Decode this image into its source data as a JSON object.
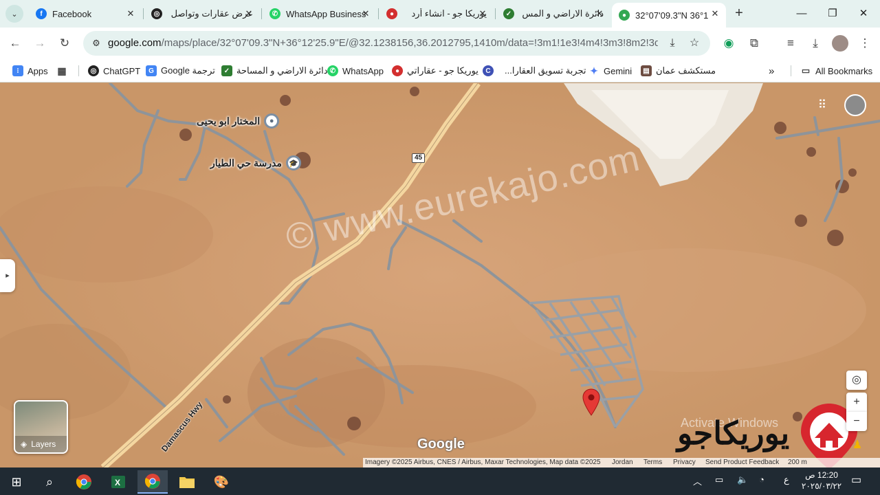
{
  "tabs": [
    {
      "title": "Facebook",
      "icon": "facebook-icon",
      "color": "#1877f2",
      "glyph": "f"
    },
    {
      "title": "عرض عقارات وتواصل",
      "icon": "openai-icon",
      "color": "#222222",
      "glyph": "◎"
    },
    {
      "title": "WhatsApp Business",
      "icon": "whatsapp-icon",
      "color": "#25d366",
      "glyph": "✆"
    },
    {
      "title": "يوريكا جو - انشاء أرد",
      "icon": "eureka-pin-icon",
      "color": "#d32f2f",
      "glyph": "●"
    },
    {
      "title": "دائرة الاراضي و المس",
      "icon": "dls-icon",
      "color": "#2e7d32",
      "glyph": "✓"
    },
    {
      "title": "32°07'09.3\"N 36°1",
      "icon": "google-maps-icon",
      "color": "#34a853",
      "glyph": "●"
    }
  ],
  "url": {
    "host": "google.com",
    "path": "/maps/place/32°07'09.3\"N+36°12'25.9\"E/@32.1238156,36.2012795,1410m/data=!3m1!1e3!4m4!3m3!8m2!3d32.119..."
  },
  "bookmarks": [
    {
      "label": "Apps",
      "icon": "apps-grid-icon",
      "color": "#4285f4",
      "glyph": "⁝"
    },
    {
      "label": "",
      "icon": "tab-groups-icon",
      "color": "#555555",
      "glyph": "▦"
    },
    {
      "label": "ChatGPT",
      "icon": "chatgpt-icon",
      "color": "#222222",
      "glyph": "◎"
    },
    {
      "label": "Google ترجمة",
      "icon": "google-translate-icon",
      "color": "#4285f4",
      "glyph": "G"
    },
    {
      "label": "دائرة الاراضي و المساحة",
      "icon": "dls-icon",
      "color": "#2e7d32",
      "glyph": "✓"
    },
    {
      "label": "WhatsApp",
      "icon": "whatsapp-icon",
      "color": "#25d366",
      "glyph": "✆"
    },
    {
      "label": "يوريكا جو - عقاراتي",
      "icon": "eureka-pin-icon",
      "color": "#d32f2f",
      "glyph": "●"
    },
    {
      "label": "",
      "icon": "circle-c-icon",
      "color": "#3f51b5",
      "glyph": "C"
    },
    {
      "label": "تجربة تسويق العقارا...",
      "icon": "",
      "color": "",
      "glyph": ""
    },
    {
      "label": "Gemini",
      "icon": "gemini-icon",
      "color": "#4f7df3",
      "glyph": "✦"
    },
    {
      "label": "مستكشف عمان",
      "icon": "amman-explorer-icon",
      "color": "#6d4c41",
      "glyph": "▤"
    }
  ],
  "all_bookmarks": "All Bookmarks",
  "map": {
    "poi_1": "المختار ابو يحيى",
    "poi_2": "مدرسة حي الطيار",
    "route_shield": "45",
    "road_name": "Damascus Hwy",
    "watermark": "© www.eurekajo.com",
    "google_logo": "Google",
    "layers_label": "Layers",
    "logo_text": "يوريكاجو",
    "activate_text": "Activate Windows",
    "attribution": {
      "imagery": "Imagery ©2025 Airbus, CNES / Airbus, Maxar Technologies, Map data ©2025",
      "country": "Jordan",
      "terms": "Terms",
      "privacy": "Privacy",
      "feedback": "Send Product Feedback",
      "scale": "200 m"
    }
  },
  "taskbar": {
    "lang": "ع",
    "time": "12:20 ص",
    "date": "٢٠٢٥/٠٣/٢٢"
  }
}
